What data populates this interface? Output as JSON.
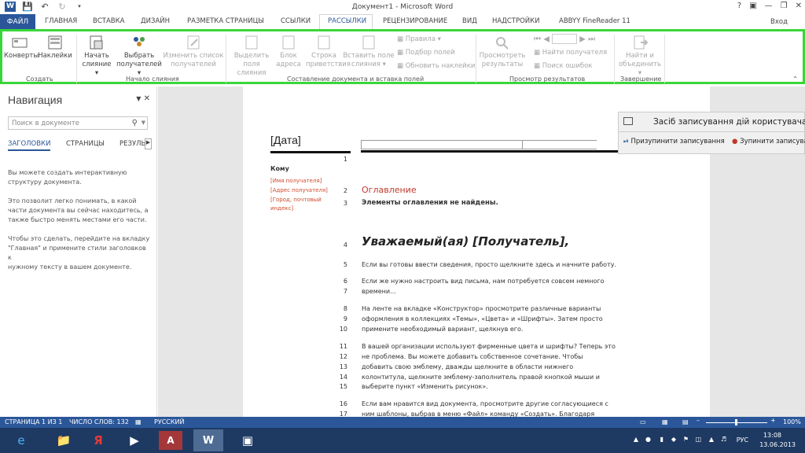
{
  "window": {
    "title": "Документ1 - Microsoft Word",
    "login": "Вход"
  },
  "tabs": [
    "ФАЙЛ",
    "ГЛАВНАЯ",
    "ВСТАВКА",
    "ДИЗАЙН",
    "РАЗМЕТКА СТРАНИЦЫ",
    "ССЫЛКИ",
    "РАССЫЛКИ",
    "РЕЦЕНЗИРОВАНИЕ",
    "ВИД",
    "НАДСТРОЙКИ",
    "ABBYY FineReader 11"
  ],
  "ribbon": {
    "groups": {
      "create": "Создать",
      "start": "Начало слияния",
      "compose": "Составление документа и вставка полей",
      "preview": "Просмотр результатов",
      "finish": "Завершение"
    },
    "buttons": {
      "envelopes": "Конверты",
      "labels": "Наклейки",
      "start_1": "Начать",
      "start_2": "слияние",
      "select_1": "Выбрать",
      "select_2": "получателей",
      "edit_1": "Изменить список",
      "edit_2": "получателей",
      "highlight_1": "Выделить",
      "highlight_2": "поля слияния",
      "address_1": "Блок",
      "address_2": "адреса",
      "greeting_1": "Строка",
      "greeting_2": "приветствия",
      "insert_1": "Вставить поле",
      "insert_2": "слияния",
      "rules": "Правила",
      "match": "Подбор полей",
      "update": "Обновить наклейки",
      "preview_1": "Просмотреть",
      "preview_2": "результаты",
      "find_recipient": "Найти получателя",
      "check_errors": "Поиск ошибок",
      "finish_1": "Найти и",
      "finish_2": "объединить"
    }
  },
  "nav": {
    "title": "Навигация",
    "search_placeholder": "Поиск в документе",
    "tabs": [
      "ЗАГОЛОВКИ",
      "СТРАНИЦЫ",
      "РЕЗУЛЬ"
    ],
    "text1": [
      "Вы можете создать интерактивную",
      "структуру документа."
    ],
    "text2": [
      "Это позволит легко понимать, в какой",
      "части документа вы сейчас находитесь, а",
      "также быстро менять местами его части."
    ],
    "text3": [
      "Чтобы это сделать, перейдите на вкладку",
      "\"Главная\" и примените стили заголовков к",
      "нужному тексту в вашем документе."
    ]
  },
  "doc": {
    "date": "[Дата]",
    "to": "Кому",
    "recipient_fields": [
      "[Имя получателя]",
      "[Адрес получателя]",
      "[Город, почтовый",
      "индекс]"
    ],
    "toc_title": "Оглавление",
    "toc_empty": "Элементы оглавления не найдены.",
    "salutation": "Уважаемый(ая) [Получатель],",
    "lines": [
      "Если вы готовы ввести сведения, просто щелкните здесь и начните работу.",
      "Если же нужно настроить вид письма, нам потребуется совсем немного",
      "времени...",
      "На ленте на вкладке «Конструктор» просмотрите различные варианты",
      "оформления в коллекциях «Темы», «Цвета» и «Шрифты». Затем просто",
      "примените необходимый вариант, щелкнув его.",
      "В вашей организации используют фирменные цвета и шрифты? Теперь это",
      "не проблема. Вы можете добавить собственное сочетание. Чтобы",
      "добавить свою эмблему, дважды щелкните в области нижнего",
      "колонтитула, щелкните эмблему-заполнитель правой кнопкой мыши и",
      "выберите пункт «Изменить рисунок».",
      "Если вам нравится вид документа, просмотрите другие согласующиеся с",
      "ним шаблоны, выбрав в меню «Файл» команду «Создать». Благодаря"
    ],
    "line_numbers": [
      "1",
      "2",
      "3",
      "4",
      "5",
      "6",
      "7",
      "8",
      "9",
      "10",
      "11",
      "12",
      "13",
      "14",
      "15",
      "16",
      "17"
    ]
  },
  "macro": {
    "title": "Засіб записування дій користувача - З",
    "pause": "Призупинити записування",
    "stop": "Зупинити записува"
  },
  "status": {
    "page": "СТРАНИЦА 1 ИЗ 1",
    "words": "ЧИСЛО СЛОВ: 132",
    "lang": "РУССКИЙ",
    "zoom": "100%"
  },
  "tray": {
    "lang": "РУС",
    "time": "13:08",
    "date": "13.06.2013"
  },
  "colors": {
    "accent": "#2b579a",
    "ribbon_border": "#39d639",
    "field": "#d04a2a",
    "heading": "#c0392b"
  }
}
